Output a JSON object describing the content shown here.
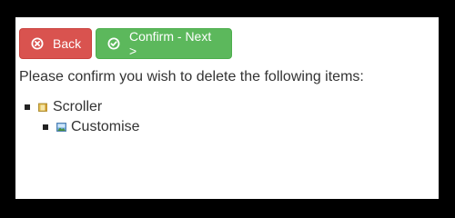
{
  "toolbar": {
    "back": {
      "label": "Back",
      "icon": "x-circle-icon",
      "color": "#d9534f"
    },
    "confirm": {
      "label": "Confirm - Next >",
      "icon": "check-circle-icon",
      "color": "#5cb85c"
    }
  },
  "message": "Please confirm you wish to delete the following items:",
  "items": [
    {
      "label": "Scroller",
      "icon": "folder-icon",
      "children": [
        {
          "label": "Customise",
          "icon": "image-icon"
        }
      ]
    }
  ]
}
